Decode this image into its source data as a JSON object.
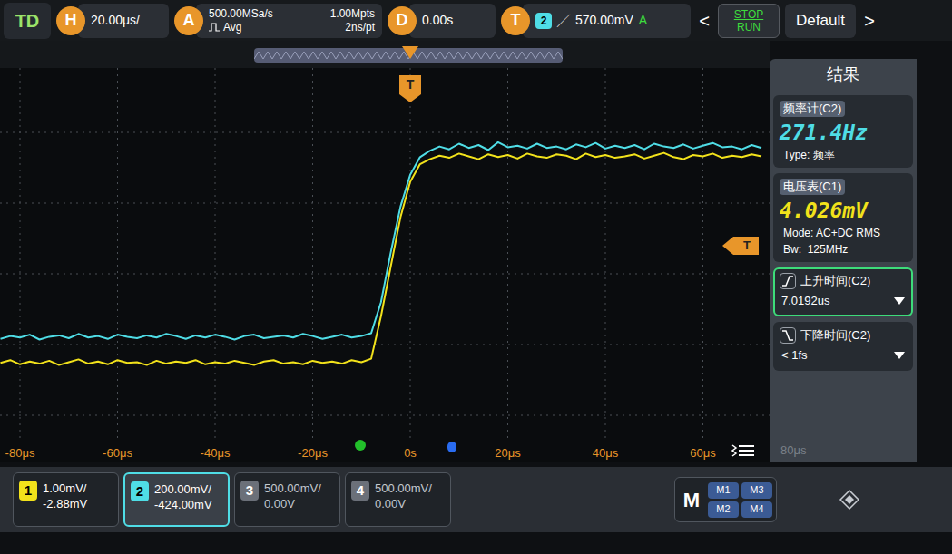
{
  "top_bar": {
    "status": "TD",
    "horizontal": {
      "key": "H",
      "value": "20.00μs/"
    },
    "acquire": {
      "key": "A",
      "sample_rate": "500.00MSa/s",
      "memory": "1.00Mpts",
      "mode": "Avg",
      "resolution": "2ns/pt"
    },
    "delay": {
      "key": "D",
      "value": "0.00s"
    },
    "trigger": {
      "key": "T",
      "source": "2",
      "edge": "╱",
      "level": "570.00mV",
      "coupling": "A"
    },
    "nav_left": "<",
    "run_stop": {
      "top": "STOP",
      "bottom": "RUN"
    },
    "default_button": "Default",
    "nav_right": ">"
  },
  "plot": {
    "trigger_marker": "T",
    "level_marker": "T",
    "time_labels": [
      "-80μs",
      "-60μs",
      "-40μs",
      "-20μs",
      "0s",
      "20μs",
      "40μs",
      "60μs"
    ],
    "t_start": -84,
    "t_step": 2,
    "traces": [
      {
        "color": "#4fdde6",
        "values": [
          -0.92,
          -0.88,
          -0.9,
          -0.86,
          -0.93,
          -0.89,
          -0.87,
          -0.91,
          -0.85,
          -0.9,
          -0.88,
          -0.92,
          -0.86,
          -0.89,
          -0.91,
          -0.87,
          -0.9,
          -0.85,
          -0.88,
          -0.92,
          -0.87,
          -0.9,
          -0.86,
          -0.89,
          -0.93,
          -0.88,
          -0.86,
          -0.91,
          -0.89,
          -0.87,
          -0.9,
          -0.85,
          -0.88,
          -0.92,
          -0.89,
          -0.86,
          -0.9,
          -0.88,
          -0.84,
          -0.4,
          0.3,
          0.95,
          1.4,
          1.65,
          1.74,
          1.8,
          1.76,
          1.84,
          1.78,
          1.82,
          1.75,
          1.86,
          1.79,
          1.81,
          1.77,
          1.84,
          1.78,
          1.8,
          1.76,
          1.83,
          1.79,
          1.85,
          1.77,
          1.81,
          1.78,
          1.82,
          1.76,
          1.84,
          1.8,
          1.78,
          1.83,
          1.77,
          1.81,
          1.85,
          1.79,
          1.8,
          1.76,
          1.82,
          1.78
        ]
      },
      {
        "color": "#f2e21b",
        "values": [
          -1.26,
          -1.22,
          -1.28,
          -1.24,
          -1.27,
          -1.23,
          -1.29,
          -1.25,
          -1.21,
          -1.27,
          -1.24,
          -1.28,
          -1.22,
          -1.26,
          -1.25,
          -1.29,
          -1.23,
          -1.27,
          -1.24,
          -1.26,
          -1.22,
          -1.28,
          -1.25,
          -1.27,
          -1.23,
          -1.26,
          -1.29,
          -1.24,
          -1.22,
          -1.27,
          -1.25,
          -1.28,
          -1.23,
          -1.26,
          -1.24,
          -1.27,
          -1.22,
          -1.25,
          -1.2,
          -0.6,
          0.1,
          0.8,
          1.3,
          1.55,
          1.62,
          1.67,
          1.64,
          1.7,
          1.66,
          1.62,
          1.69,
          1.65,
          1.68,
          1.63,
          1.7,
          1.66,
          1.64,
          1.69,
          1.67,
          1.62,
          1.7,
          1.65,
          1.68,
          1.64,
          1.66,
          1.69,
          1.63,
          1.67,
          1.71,
          1.65,
          1.62,
          1.68,
          1.66,
          1.7,
          1.64,
          1.67,
          1.65,
          1.69,
          1.66
        ]
      }
    ],
    "cursor_dots": [
      {
        "color": "#22c02a"
      },
      {
        "color": "#2a6cf0"
      }
    ]
  },
  "results": {
    "title": "结果",
    "items": [
      {
        "kind": "readout",
        "label": "频率计(C2)",
        "value": "271.4Hz",
        "details": [
          "Type: 频率"
        ],
        "color": "#4fdde6",
        "selected": false
      },
      {
        "kind": "readout",
        "label": "电压表(C1)",
        "value": "4.026mV",
        "details": [
          "Mode: AC+DC RMS",
          "Bw:  125MHz"
        ],
        "color": "#f2e21b",
        "selected": false
      },
      {
        "kind": "rise",
        "label": "上升时间(C2)",
        "value": "7.0192us",
        "selected": true
      },
      {
        "kind": "fall",
        "label": "下降时间(C2)",
        "value": "< 1fs",
        "selected": false
      }
    ],
    "footer": "80μs"
  },
  "channels": [
    {
      "number": "1",
      "scale": "1.00mV/",
      "offset": "-2.88mV",
      "color": "#f2e21b",
      "on": true,
      "selected": false
    },
    {
      "number": "2",
      "scale": "200.00mV/",
      "offset": "-424.00mV",
      "color": "#4fdde6",
      "on": true,
      "selected": true
    },
    {
      "number": "3",
      "scale": "500.00mV/",
      "offset": "0.00V",
      "color": "#c060d0",
      "on": false,
      "selected": false
    },
    {
      "number": "4",
      "scale": "500.00mV/",
      "offset": "0.00V",
      "color": "#3b7bef",
      "on": false,
      "selected": false
    }
  ],
  "math": {
    "label": "M",
    "items": [
      "M1",
      "M3",
      "M2",
      "M4"
    ]
  }
}
